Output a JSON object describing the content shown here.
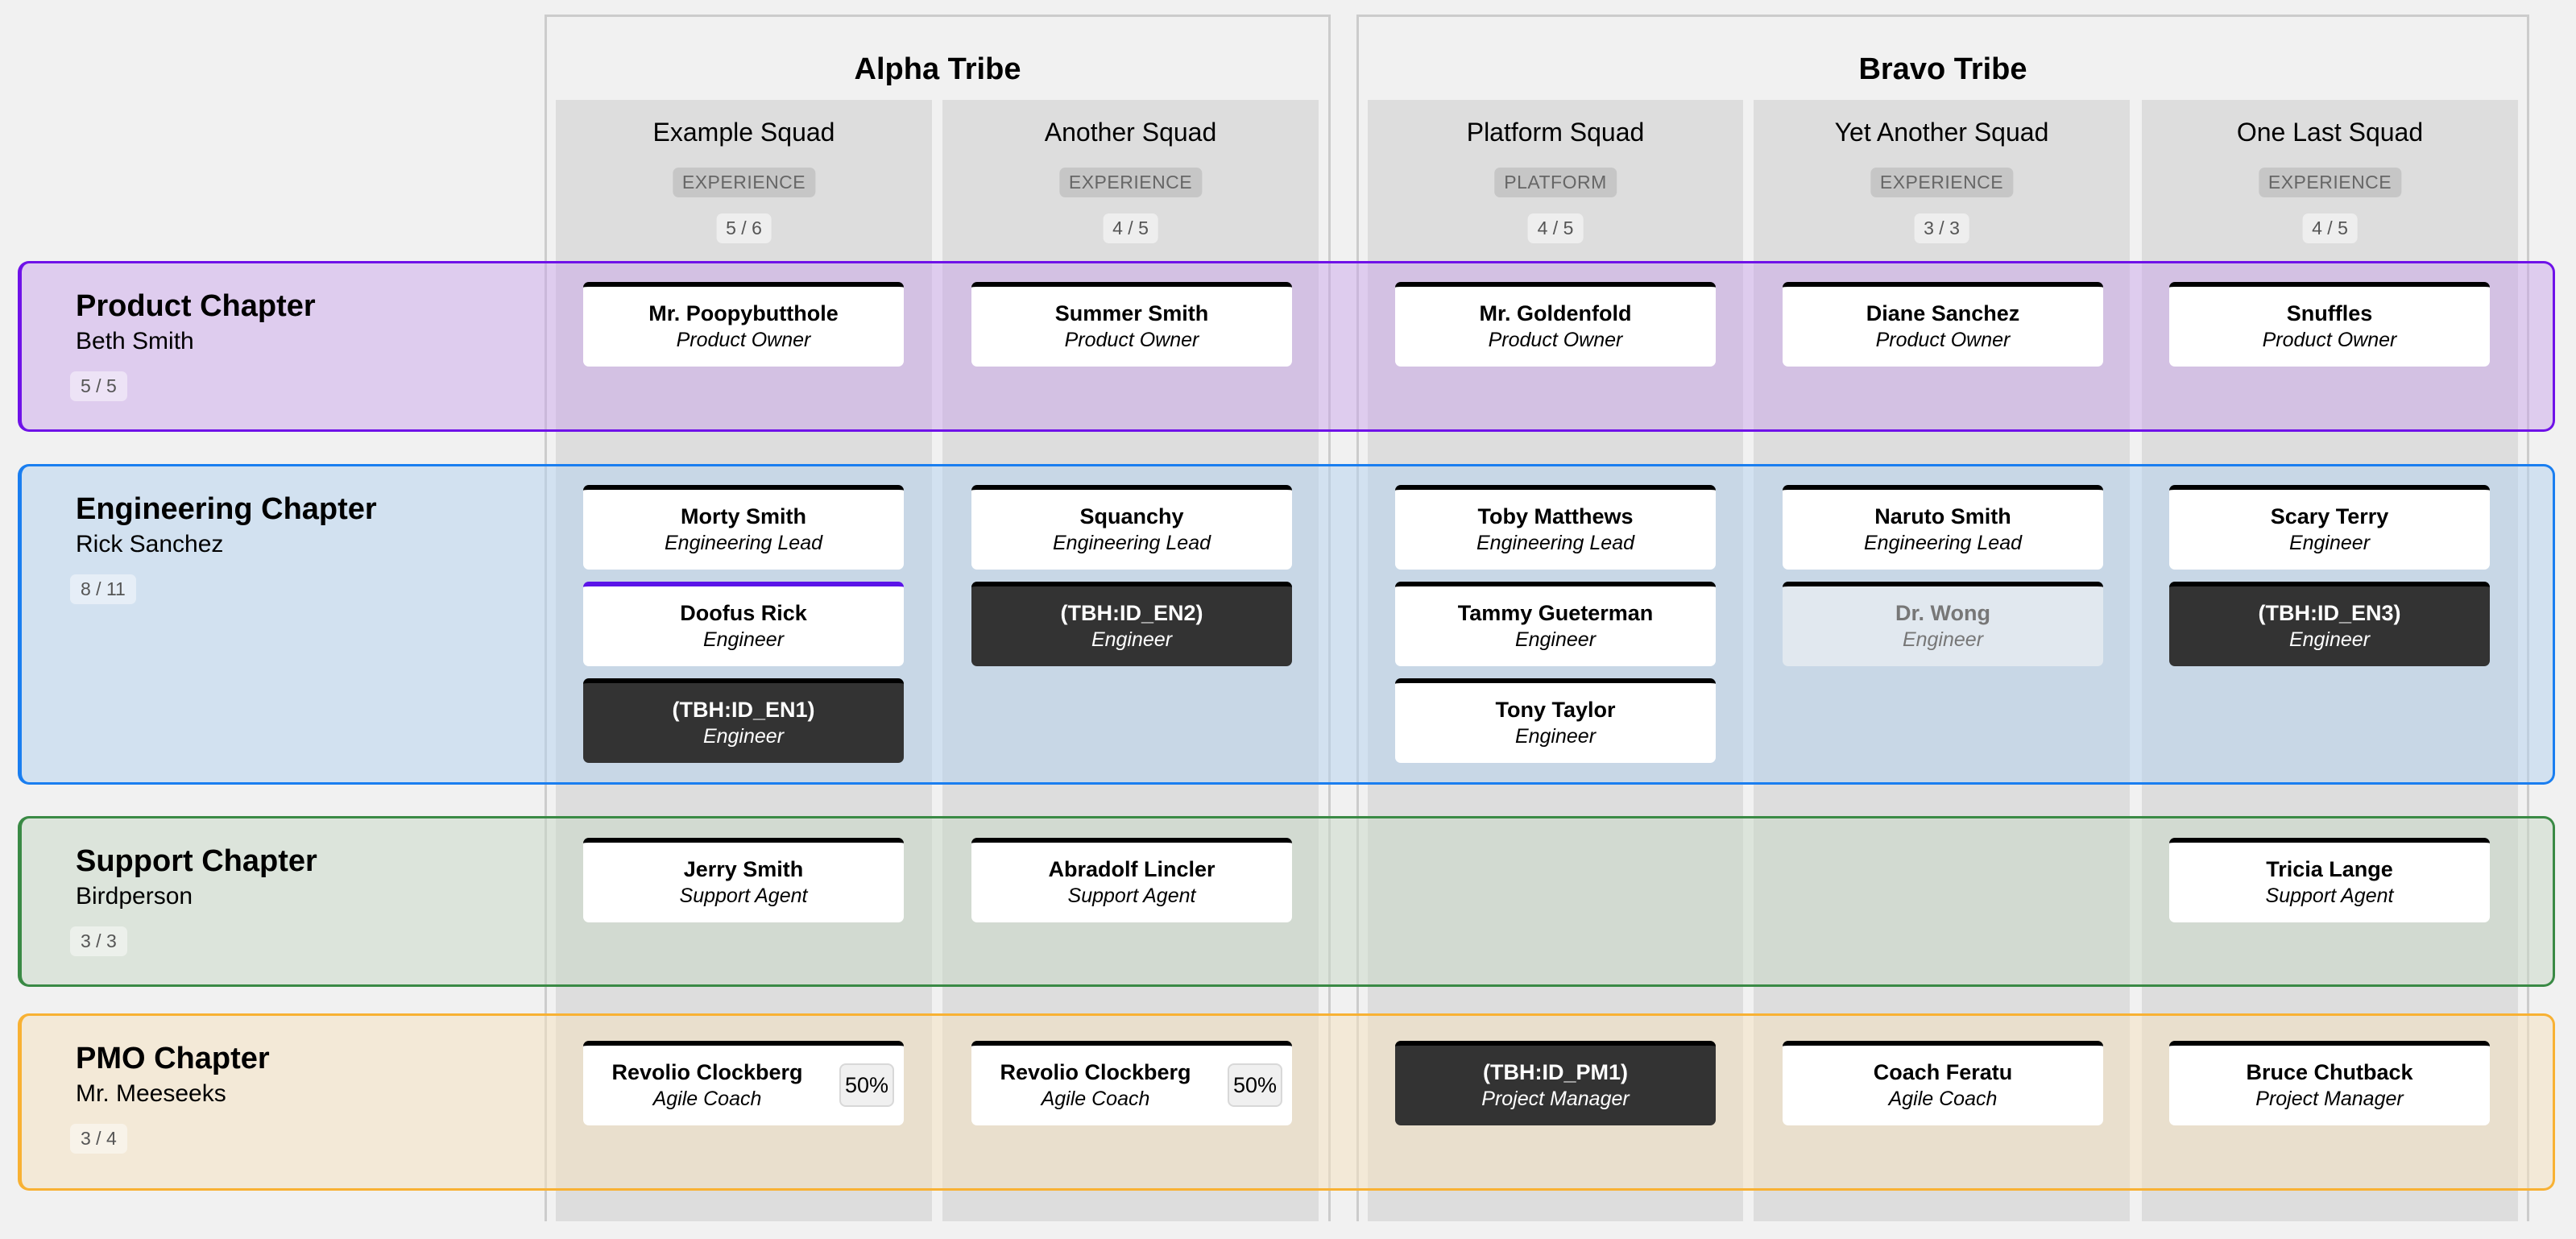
{
  "tribes": [
    {
      "name": "Alpha Tribe",
      "squads": [
        {
          "name": "Example Squad",
          "tag": "EXPERIENCE",
          "count": "5 / 6"
        },
        {
          "name": "Another Squad",
          "tag": "EXPERIENCE",
          "count": "4 / 5"
        }
      ]
    },
    {
      "name": "Bravo Tribe",
      "squads": [
        {
          "name": "Platform Squad",
          "tag": "PLATFORM",
          "count": "4 / 5"
        },
        {
          "name": "Yet Another Squad",
          "tag": "EXPERIENCE",
          "count": "3 / 3"
        },
        {
          "name": "One Last Squad",
          "tag": "EXPERIENCE",
          "count": "4 / 5"
        }
      ]
    }
  ],
  "chapters": [
    {
      "name": "Product Chapter",
      "lead": "Beth Smith",
      "count": "5 / 5",
      "color": "#6f12e8",
      "bg": "#e4d8f0"
    },
    {
      "name": "Engineering Chapter",
      "lead": "Rick Sanchez",
      "count": "8 / 11",
      "color": "#1a7ef0",
      "bg": "#d6e4f1"
    },
    {
      "name": "Support Chapter",
      "lead": "Birdperson",
      "count": "3 / 3",
      "color": "#3a8a45",
      "bg": "#dfe5de"
    },
    {
      "name": "PMO Chapter",
      "lead": "Mr. Meeseeks",
      "count": "3 / 4",
      "color": "#f8b133",
      "bg": "#f3eadb"
    }
  ],
  "cards": {
    "product": [
      {
        "name": "Mr. Poopybutthole",
        "role": "Product Owner"
      },
      {
        "name": "Summer Smith",
        "role": "Product Owner"
      },
      {
        "name": "Mr. Goldenfold",
        "role": "Product Owner"
      },
      {
        "name": "Diane Sanchez",
        "role": "Product Owner"
      },
      {
        "name": "Snuffles",
        "role": "Product Owner"
      }
    ],
    "engineering": [
      {
        "name": "Morty Smith",
        "role": "Engineering Lead"
      },
      {
        "name": "Doofus Rick",
        "role": "Engineer",
        "state": "accent"
      },
      {
        "name": "(TBH:ID_EN1)",
        "role": "Engineer",
        "state": "tbh"
      },
      {
        "name": "Squanchy",
        "role": "Engineering Lead"
      },
      {
        "name": "(TBH:ID_EN2)",
        "role": "Engineer",
        "state": "tbh"
      },
      {
        "name": "Toby Matthews",
        "role": "Engineering Lead"
      },
      {
        "name": "Tammy Gueterman",
        "role": "Engineer"
      },
      {
        "name": "Tony Taylor",
        "role": "Engineer"
      },
      {
        "name": "Naruto Smith",
        "role": "Engineering Lead"
      },
      {
        "name": "Dr. Wong",
        "role": "Engineer",
        "state": "disabled"
      },
      {
        "name": "Scary Terry",
        "role": "Engineer"
      },
      {
        "name": "(TBH:ID_EN3)",
        "role": "Engineer",
        "state": "tbh"
      }
    ],
    "support": [
      {
        "name": "Jerry Smith",
        "role": "Support Agent"
      },
      {
        "name": "Abradolf Lincler",
        "role": "Support Agent"
      },
      {
        "name": "Tricia Lange",
        "role": "Support Agent"
      }
    ],
    "pmo": [
      {
        "name": "Revolio Clockberg",
        "role": "Agile Coach",
        "allocation": "50%"
      },
      {
        "name": "Revolio Clockberg",
        "role": "Agile Coach",
        "allocation": "50%"
      },
      {
        "name": "(TBH:ID_PM1)",
        "role": "Project Manager",
        "state": "tbh"
      },
      {
        "name": "Coach Feratu",
        "role": "Agile Coach"
      },
      {
        "name": "Bruce Chutback",
        "role": "Project Manager"
      }
    ]
  }
}
